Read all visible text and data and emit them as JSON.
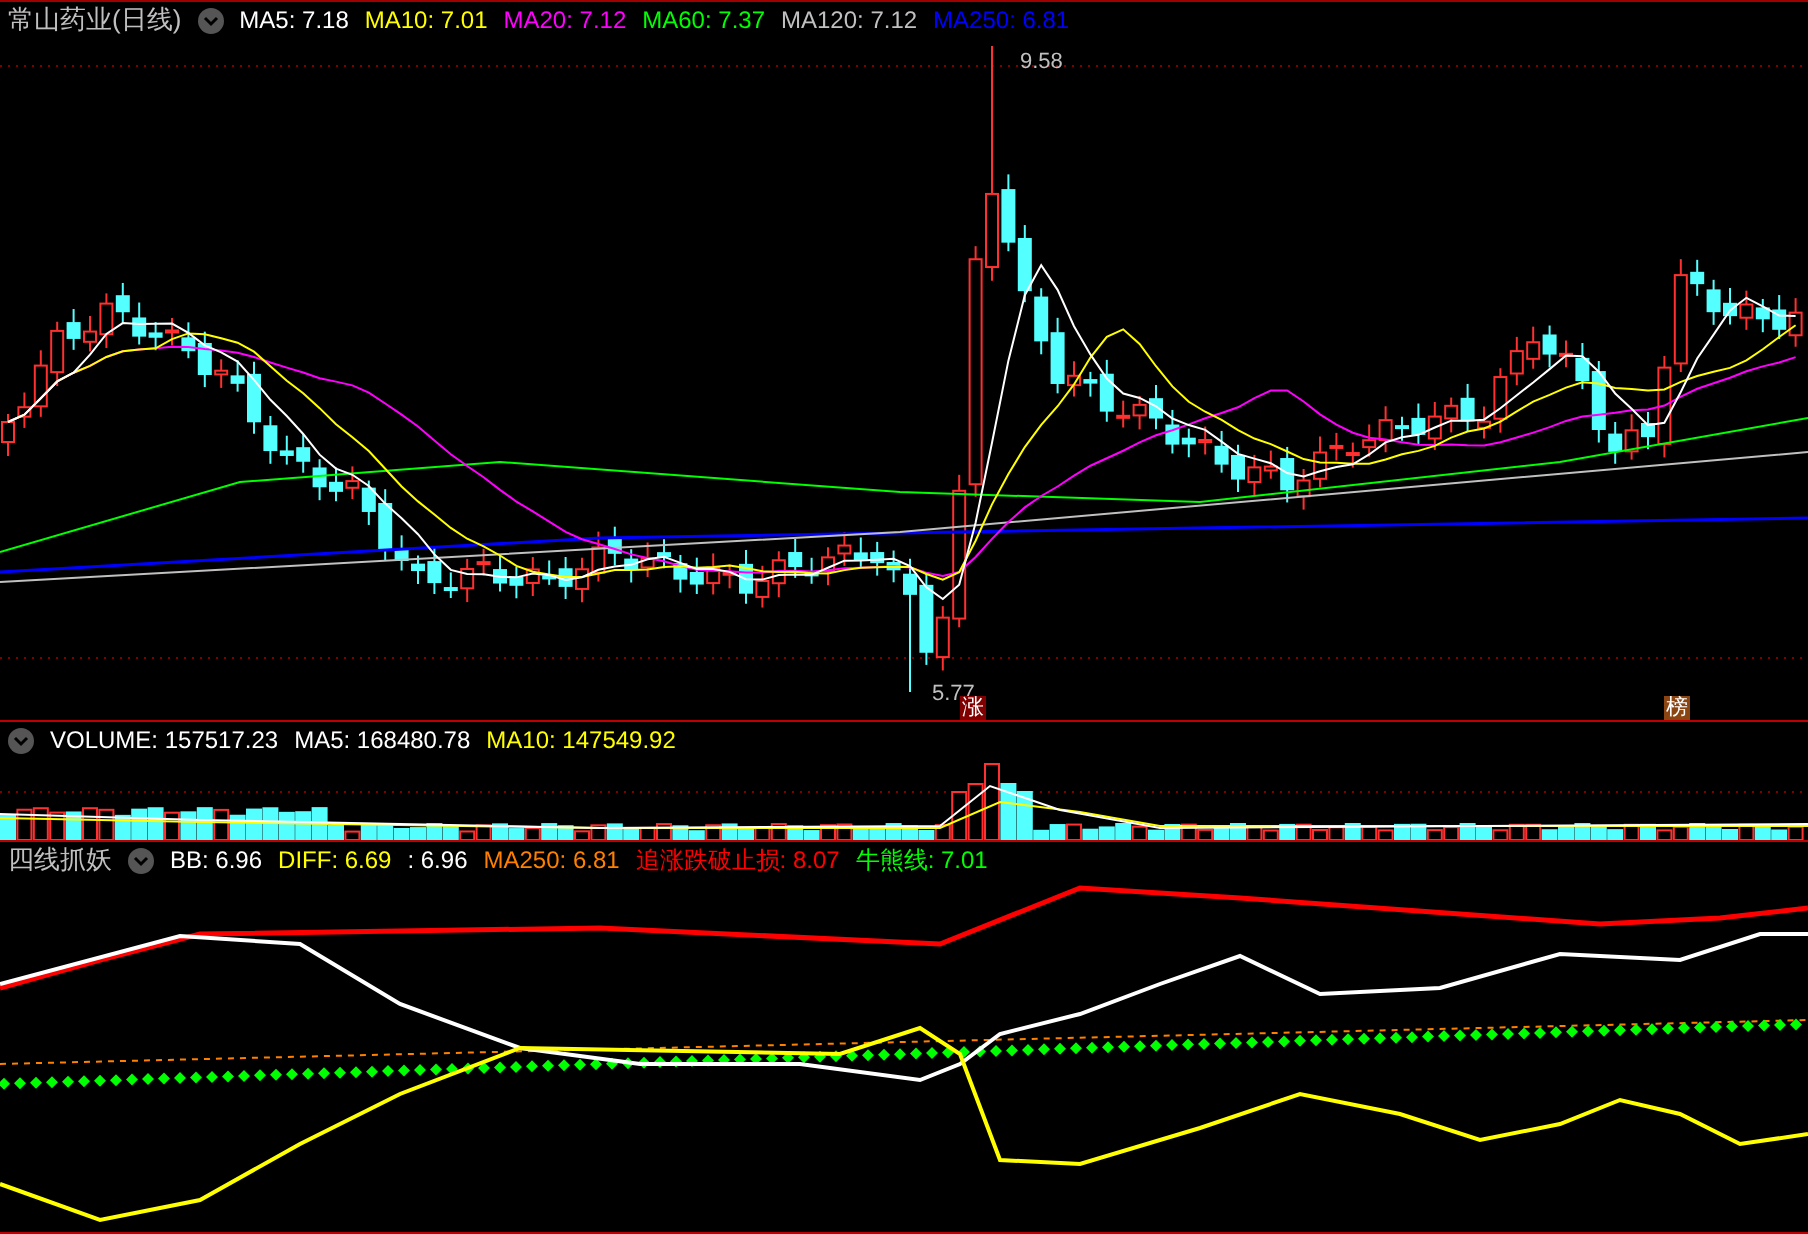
{
  "price_panel": {
    "title": "常山药业(日线)",
    "indicators": [
      {
        "label": "MA5: 7.18",
        "color": "#ffffff"
      },
      {
        "label": "MA10: 7.01",
        "color": "#ffff00"
      },
      {
        "label": "MA20: 7.12",
        "color": "#ff00ff"
      },
      {
        "label": "MA60: 7.37",
        "color": "#00ff00"
      },
      {
        "label": "MA120: 7.12",
        "color": "#c0c0c0"
      },
      {
        "label": "MA250: 6.81",
        "color": "#0000ff"
      }
    ],
    "high_label": "9.58",
    "low_label": "5.77",
    "markers": [
      {
        "text": "涨",
        "color": "#800000"
      },
      {
        "text": "榜",
        "color": "#8b4513"
      }
    ]
  },
  "volume_panel": {
    "indicators": [
      {
        "label": "VOLUME: 157517.23",
        "color": "#ffffff"
      },
      {
        "label": "MA5: 168480.78",
        "color": "#ffffff"
      },
      {
        "label": "MA10: 147549.92",
        "color": "#ffff00"
      }
    ]
  },
  "indicator_panel": {
    "title": "四线抓妖",
    "indicators": [
      {
        "label": "BB: 6.96",
        "color": "#ffffff"
      },
      {
        "label": "DIFF: 6.69",
        "color": "#ffff00"
      },
      {
        "label": ": 6.96",
        "color": "#ffffff"
      },
      {
        "label": "MA250: 6.81",
        "color": "#ff8000"
      },
      {
        "label": "追涨跌破止损: 8.07",
        "color": "#ff0000"
      },
      {
        "label": "牛熊线: 7.01",
        "color": "#00ff00"
      }
    ]
  }
}
